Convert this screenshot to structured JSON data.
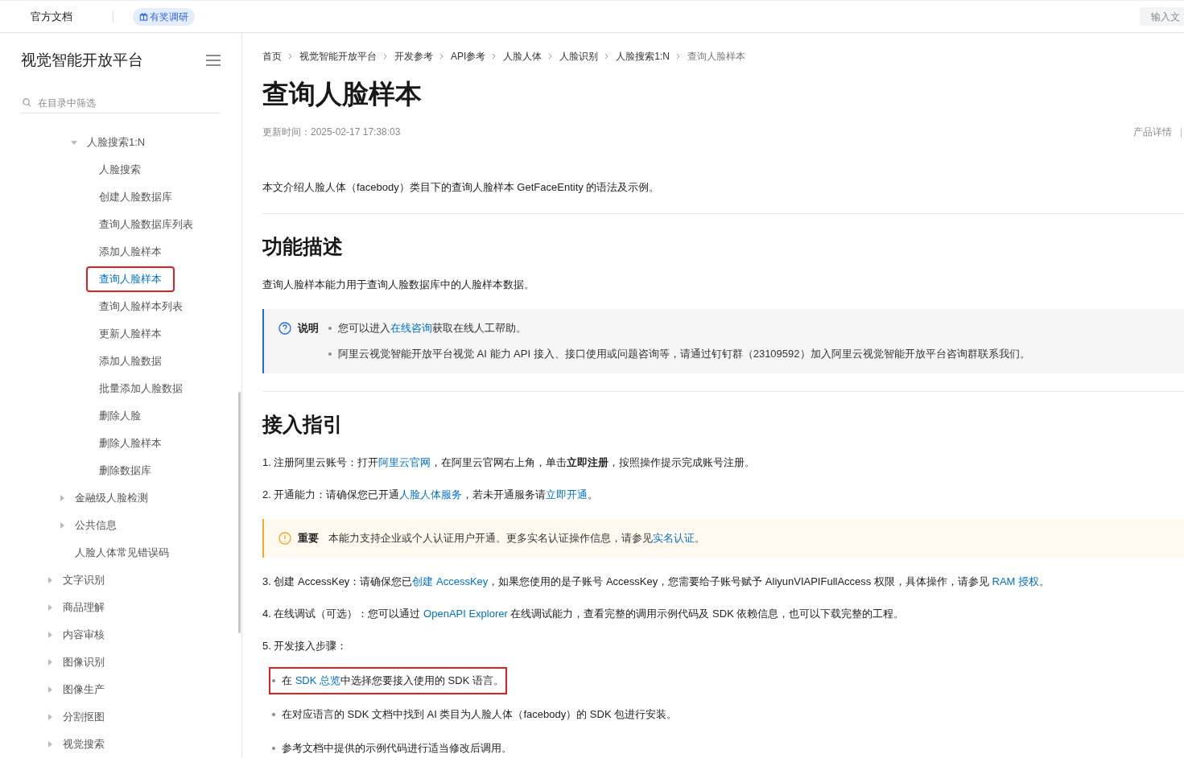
{
  "top_bar": {
    "doc_label": "官方文档",
    "survey_badge": "有奖调研",
    "search": {
      "placeholder": "输入文"
    }
  },
  "sidebar": {
    "title": "视觉智能开放平台",
    "filter": {
      "placeholder": "在目录中筛选"
    },
    "tree": [
      {
        "children": [
          {
            "children": [
              {
                "label": "人脸搜索1:N",
                "expanded": true,
                "children": [
                  {
                    "label": "人脸搜索",
                    "selected": false,
                    "annotated": false
                  },
                  {
                    "label": "创建人脸数据库",
                    "selected": false,
                    "annotated": false
                  },
                  {
                    "label": "查询人脸数据库列表",
                    "selected": false,
                    "annotated": false
                  },
                  {
                    "label": "添加人脸样本",
                    "selected": false,
                    "annotated": false
                  },
                  {
                    "label": "查询人脸样本",
                    "selected": true,
                    "annotated": true
                  },
                  {
                    "label": "查询人脸样本列表",
                    "selected": false,
                    "annotated": false
                  },
                  {
                    "label": "更新人脸样本",
                    "selected": false,
                    "annotated": false
                  },
                  {
                    "label": "添加人脸数据",
                    "selected": false,
                    "annotated": false
                  },
                  {
                    "label": "批量添加人脸数据",
                    "selected": false,
                    "annotated": false
                  },
                  {
                    "label": "删除人脸",
                    "selected": false,
                    "annotated": false
                  },
                  {
                    "label": "删除人脸样本",
                    "selected": false,
                    "annotated": false
                  },
                  {
                    "label": "删除数据库",
                    "selected": false,
                    "annotated": false
                  }
                ]
              }
            ]
          },
          {
            "label": "金融级人脸检测",
            "expanded": false
          },
          {
            "label": "公共信息",
            "expanded": false
          },
          {
            "label": "人脸人体常见错误码"
          }
        ]
      },
      {
        "label": "文字识别",
        "expanded": false
      },
      {
        "label": "商品理解",
        "expanded": false
      },
      {
        "label": "内容审核",
        "expanded": false
      },
      {
        "label": "图像识别",
        "expanded": false
      },
      {
        "label": "图像生产",
        "expanded": false
      },
      {
        "label": "分割抠图",
        "expanded": false
      },
      {
        "label": "视觉搜索",
        "expanded": false
      }
    ]
  },
  "breadcrumb": [
    "首页",
    "视觉智能开放平台",
    "开发参考",
    "API参考",
    "人脸人体",
    "人脸识别",
    "人脸搜索1:N",
    "查询人脸样本"
  ],
  "title": "查询人脸样本",
  "updated": "更新时间：2025-02-17 17:38:03",
  "product_link": "产品详情",
  "product_sep": "|",
  "intro": "本文介绍人脸人体（facebody）类目下的查询人脸样本 GetFaceEntity 的语法及示例。",
  "sections": [
    {
      "heading": "功能描述",
      "blocks": [
        {
          "kind": "para",
          "segments": [
            {
              "text": "查询人脸样本能力用于查询人脸数据库中的人脸样本数据。"
            }
          ]
        },
        {
          "kind": "info_note",
          "label": "说明",
          "items": [
            [
              {
                "text": "您可以进入"
              },
              {
                "text": "在线咨询",
                "link": true
              },
              {
                "text": "获取在线人工帮助。"
              }
            ],
            [
              {
                "text": "阿里云视觉智能开放平台视觉 AI 能力 API 接入、接口使用或问题咨询等，请通过钉钉群（23109592）加入阿里云视觉智能开放平台咨询群联系我们。"
              }
            ]
          ]
        }
      ]
    },
    {
      "heading": "接入指引",
      "blocks": [
        {
          "kind": "para",
          "segments": [
            {
              "text": "1. 注册阿里云账号：打开"
            },
            {
              "text": "阿里云官网",
              "link": true
            },
            {
              "text": "，在阿里云官网右上角，单击"
            },
            {
              "text": "立即注册",
              "bold": true
            },
            {
              "text": "，按照操作提示完成账号注册。"
            }
          ]
        },
        {
          "kind": "para",
          "segments": [
            {
              "text": "2. 开通能力：请确保您已开通"
            },
            {
              "text": "人脸人体服务",
              "link": true
            },
            {
              "text": "，若未开通服务请"
            },
            {
              "text": "立即开通",
              "link": true
            },
            {
              "text": "。"
            }
          ]
        },
        {
          "kind": "warning_note",
          "label": "重要",
          "items": [
            [
              {
                "text": "本能力支持企业或个人认证用户开通。更多实名认证操作信息，请参见"
              },
              {
                "text": "实名认证",
                "link": true
              },
              {
                "text": "。"
              }
            ]
          ]
        },
        {
          "kind": "para",
          "segments": [
            {
              "text": "3. 创建 AccessKey：请确保您已"
            },
            {
              "text": "创建 AccessKey",
              "link": true
            },
            {
              "text": "，如果您使用的是子账号 AccessKey，您需要给子账号赋予 AliyunVIAPIFullAccess 权限，具体操作，请参见 "
            },
            {
              "text": "RAM 授权",
              "link": true
            },
            {
              "text": "。"
            }
          ]
        },
        {
          "kind": "para",
          "segments": [
            {
              "text": "4. 在线调试（可选）：您可以通过 "
            },
            {
              "text": "OpenAPI Explorer",
              "link": true
            },
            {
              "text": " 在线调试能力，查看完整的调用示例代码及 SDK 依赖信息，也可以下载完整的工程。"
            }
          ]
        },
        {
          "kind": "para",
          "segments": [
            {
              "text": "5. 开发接入步骤："
            }
          ]
        },
        {
          "kind": "bullets",
          "items": [
            {
              "annotated": true,
              "segments": [
                {
                  "text": "在 "
                },
                {
                  "text": "SDK 总览",
                  "link": true
                },
                {
                  "text": "中选择您要接入使用的 SDK 语言。"
                }
              ]
            },
            {
              "annotated": false,
              "segments": [
                {
                  "text": "在对应语言的 SDK 文档中找到 AI 类目为人脸人体（facebody）的 SDK 包进行安装。"
                }
              ]
            },
            {
              "annotated": false,
              "segments": [
                {
                  "text": "参考文档中提供的示例代码进行适当修改后调用。"
                }
              ]
            }
          ]
        }
      ]
    }
  ]
}
